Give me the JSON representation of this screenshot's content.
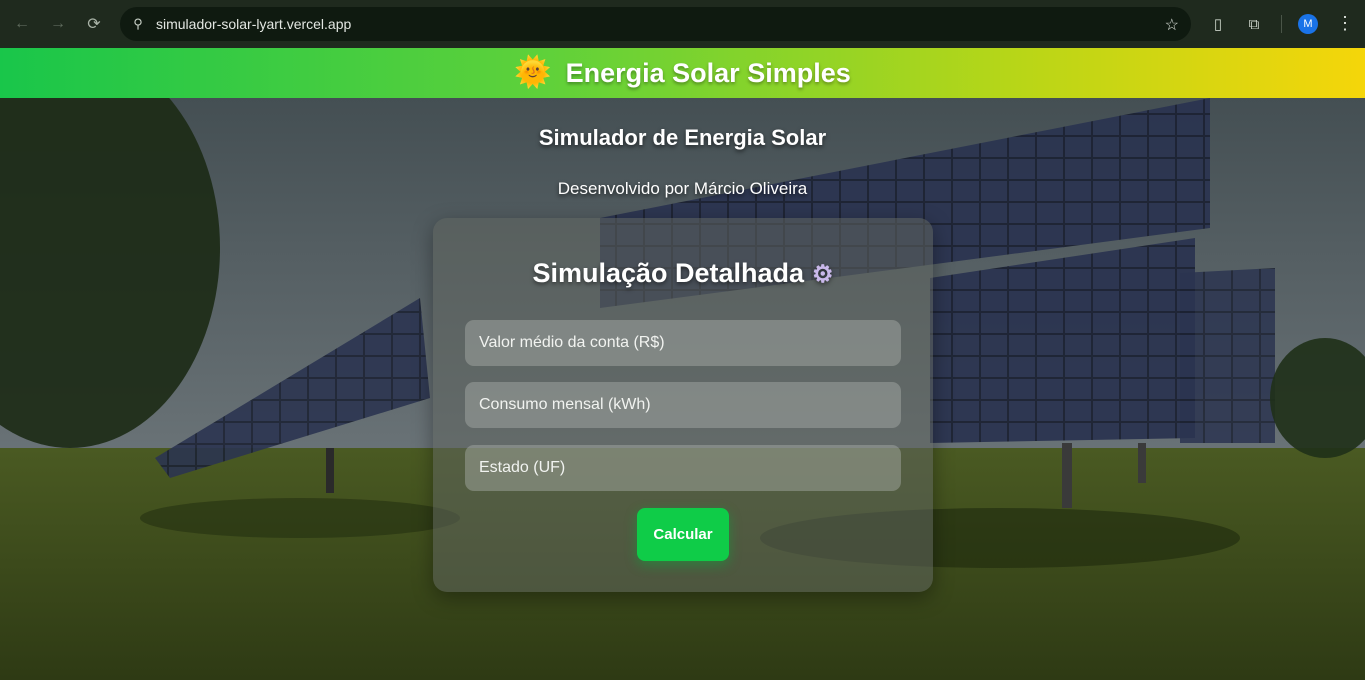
{
  "browser": {
    "url": "simulador-solar-lyart.vercel.app",
    "profile_initial": "M"
  },
  "banner": {
    "emoji": "🌞",
    "title": "Energia Solar Simples"
  },
  "page": {
    "subtitle": "Simulador de Energia Solar",
    "credit": "Desenvolvido por Márcio Oliveira"
  },
  "form": {
    "title": "Simulação Detalhada",
    "gear_icon": "⚙",
    "bill_placeholder": "Valor médio da conta (R$)",
    "consumption_placeholder": "Consumo mensal (kWh)",
    "state_placeholder": "Estado (UF)",
    "submit_label": "Calcular"
  },
  "colors": {
    "accent_green": "#0fcc48",
    "banner_start": "#19c64a",
    "banner_end": "#f5d60a"
  }
}
